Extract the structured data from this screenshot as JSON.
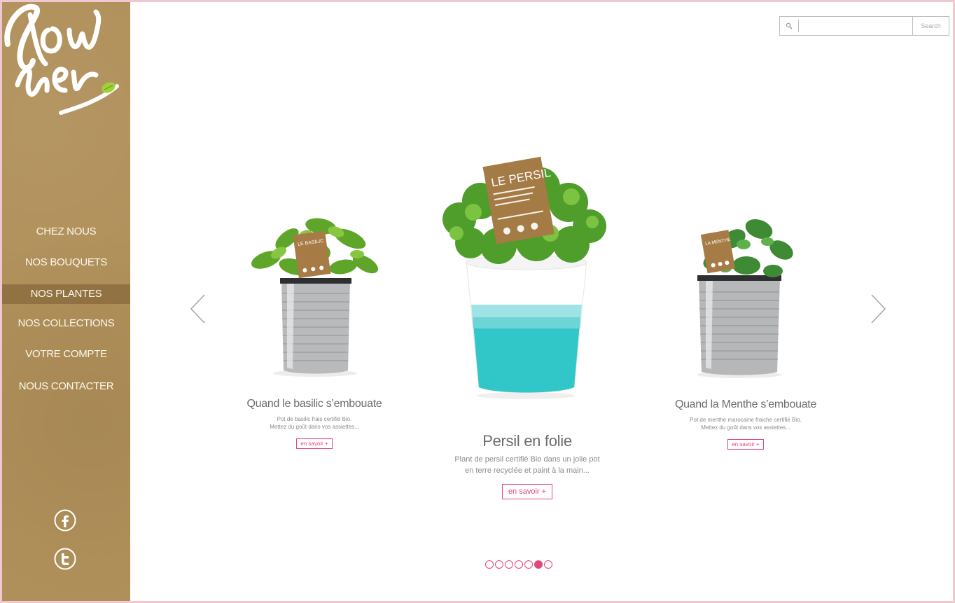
{
  "brand": {
    "logo_text_line1": "flow",
    "logo_text_line2": "her"
  },
  "nav": {
    "items": [
      {
        "label": "CHEZ NOUS"
      },
      {
        "label": "NOS BOUQUETS"
      },
      {
        "label": "NOS PLANTES"
      },
      {
        "label": "NOS COLLECTIONS"
      },
      {
        "label": "VOTRE COMPTE"
      },
      {
        "label": "NOUS CONTACTER"
      }
    ],
    "active_index": 2
  },
  "social": {
    "facebook_icon": "facebook-icon",
    "twitter_icon": "twitter-icon"
  },
  "search": {
    "placeholder": "",
    "value": "",
    "button_label": "Search"
  },
  "carousel": {
    "products": [
      {
        "title": "Quand le basilic s’embouate",
        "desc_line1": "Pot de basilic frais certifié Bio.",
        "desc_line2": "Mettez du goût dans vos assiettes...",
        "button": "en savoir +",
        "tag_text": "LE BASILIC"
      },
      {
        "title": "Persil en folie",
        "desc_line1": "Plant de persil certifié Bio dans un jolie pot",
        "desc_line2": "en terre recyclée et paint à la main...",
        "button": "en savoir +",
        "tag_text": "LE PERSIL"
      },
      {
        "title": "Quand la Menthe s’embouate",
        "desc_line1": "Pot de menthe marocaine fraiche certifié Bio.",
        "desc_line2": "Mettez du goût dans vos assiettes...",
        "button": "en savoir +",
        "tag_text": "LA MENTHE"
      }
    ],
    "dots_total": 7,
    "active_dot": 5
  },
  "colors": {
    "accent": "#e2477c",
    "kraft": "#b0905a",
    "sidebar_text": "#fdf7ea",
    "teal": "#31c7c9"
  }
}
